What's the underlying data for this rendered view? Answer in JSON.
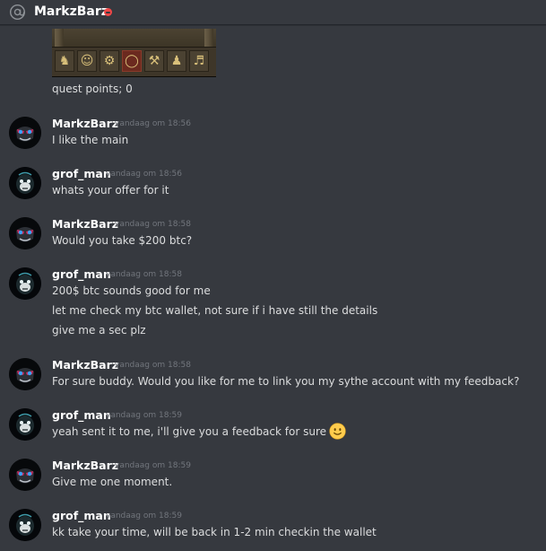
{
  "header": {
    "icon": "at-sign-icon",
    "title": "MarkzBarz",
    "status": "do-not-disturb",
    "status_color": "#f04747"
  },
  "colors": {
    "background": "#36393f",
    "text": "#dcddde",
    "username": "#ffffff",
    "timestamp": "#72767d"
  },
  "embed": {
    "image": "game-skills-interface",
    "caption": "quest points; 0"
  },
  "messages": [
    {
      "author": "MarkzBarz",
      "timestamp": "vandaag om 18:56",
      "avatar": "blue-eyed-mask-avatar",
      "lines": [
        "I like the main"
      ]
    },
    {
      "author": "grof_man",
      "timestamp": "vandaag om 18:56",
      "avatar": "monkey-avatar",
      "lines": [
        "whats your offer for it"
      ]
    },
    {
      "author": "MarkzBarz",
      "timestamp": "vandaag om 18:58",
      "avatar": "blue-eyed-mask-avatar",
      "lines": [
        "Would you take $200 btc?"
      ]
    },
    {
      "author": "grof_man",
      "timestamp": "vandaag om 18:58",
      "avatar": "monkey-avatar",
      "lines": [
        "200$ btc sounds good for me",
        "let me check my btc wallet, not sure if i have still the details",
        "give me a sec plz"
      ]
    },
    {
      "author": "MarkzBarz",
      "timestamp": "vandaag om 18:58",
      "avatar": "blue-eyed-mask-avatar",
      "lines": [
        "For sure buddy. Would you like for me to link you my sythe account with my feedback?"
      ]
    },
    {
      "author": "grof_man",
      "timestamp": "vandaag om 18:59",
      "avatar": "monkey-avatar",
      "lines": [
        "yeah sent it to me, i'll give you a feedback for sure"
      ],
      "emoji": "slightly-smiling-face-icon"
    },
    {
      "author": "MarkzBarz",
      "timestamp": "vandaag om 18:59",
      "avatar": "blue-eyed-mask-avatar",
      "lines": [
        "Give me one moment."
      ]
    },
    {
      "author": "grof_man",
      "timestamp": "vandaag om 18:59",
      "avatar": "monkey-avatar",
      "lines": [
        "kk take your time, will be back in 1-2 min checkin the wallet"
      ]
    }
  ]
}
